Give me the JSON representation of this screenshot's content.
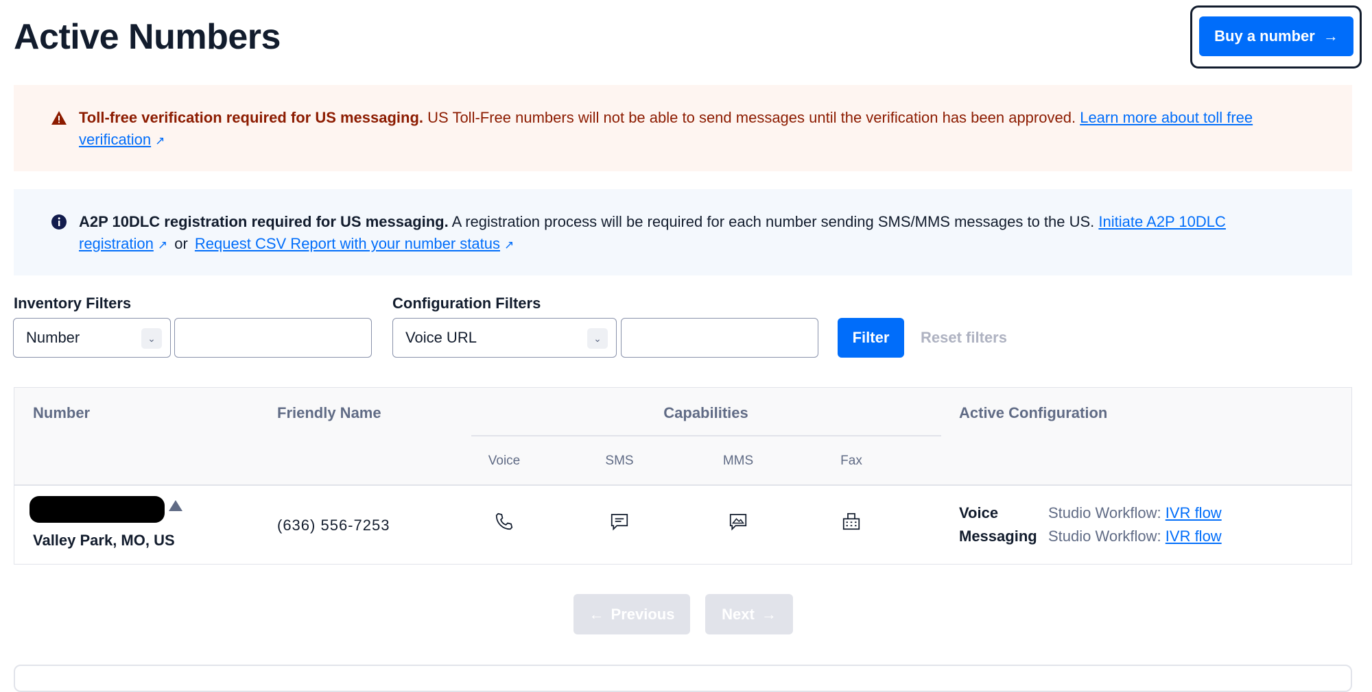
{
  "page": {
    "title": "Active Numbers"
  },
  "header": {
    "buy_label": "Buy a number",
    "buy_icon": "arrow-right-icon"
  },
  "warning_banner": {
    "title": "Toll-free verification required for US messaging.",
    "text": "US Toll-Free numbers will not be able to send messages until the verification has been approved.",
    "link": "Learn more about toll free verification",
    "color": "#8c1b00",
    "background": "#fef5f1"
  },
  "info_banner": {
    "title": "A2P 10DLC registration required for US messaging.",
    "text": "A registration process will be required for each number sending SMS/MMS messages to the US.",
    "link1": "Initiate A2P 10DLC registration",
    "or": "or",
    "link2": "Request CSV Report with your number status",
    "background": "#f4f8fd"
  },
  "filters": {
    "inventory_label": "Inventory Filters",
    "inventory_select": "Number",
    "inventory_value": "",
    "config_label": "Configuration Filters",
    "config_select": "Voice URL",
    "config_value": "",
    "filter_label": "Filter",
    "reset_label": "Reset filters"
  },
  "table": {
    "headers": {
      "number": "Number",
      "friendly": "Friendly Name",
      "capabilities": "Capabilities",
      "active": "Active Configuration"
    },
    "cap_headers": [
      "Voice",
      "SMS",
      "MMS",
      "Fax"
    ],
    "rows": [
      {
        "number": "[redacted]",
        "location": "Valley Park, MO, US",
        "friendly": "(636) 556-7253",
        "capabilities": [
          "phone-icon",
          "sms-icon",
          "mms-icon",
          "fax-icon"
        ],
        "config": [
          {
            "type": "Voice",
            "prefix": "Studio Workflow:",
            "link": "IVR flow"
          },
          {
            "type": "Messaging",
            "prefix": "Studio Workflow:",
            "link": "IVR flow"
          }
        ]
      }
    ]
  },
  "pagination": {
    "previous": "Previous",
    "next": "Next"
  },
  "colors": {
    "primary": "#006dfa",
    "text": "#121c2d",
    "muted": "#606b85"
  }
}
